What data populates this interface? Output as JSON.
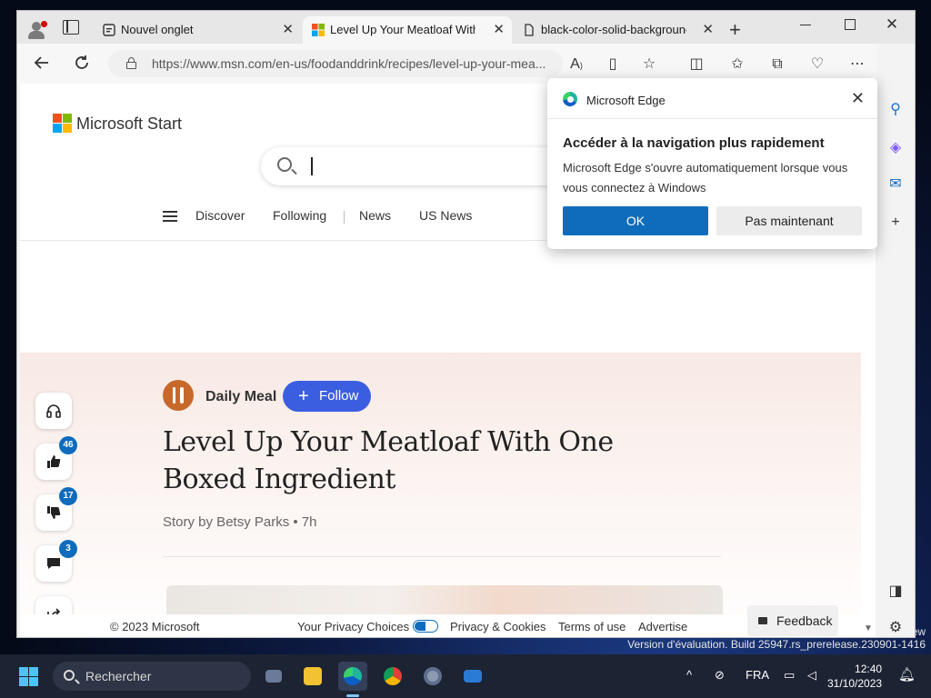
{
  "browser": {
    "tabs": [
      {
        "label": "Nouvel onglet",
        "close": "✕"
      },
      {
        "label": "Level Up Your Meatloaf With O",
        "close": "✕"
      },
      {
        "label": "black-color-solid-background-",
        "close": "✕"
      }
    ],
    "new_tab": "+",
    "url": "https://www.msn.com/en-us/foodanddrink/recipes/level-up-your-mea...",
    "window_close": "✕"
  },
  "site": {
    "brand": "Microsoft Start",
    "nav": [
      "Discover",
      "Following",
      "News",
      "US News"
    ]
  },
  "article": {
    "publisher": "Daily Meal",
    "follow_label": "Follow",
    "follow_plus": "+",
    "headline": "Level Up Your Meatloaf With One Boxed Ingredient",
    "byline": "Story by Betsy Parks  •  7h",
    "reactions": {
      "likes": "46",
      "dislikes": "17",
      "comments": "3"
    }
  },
  "footer": {
    "copyright": "© 2023 Microsoft",
    "privacy_choices": "Your Privacy Choices",
    "privacy_cookies": "Privacy & Cookies",
    "terms": "Terms of use",
    "advertise": "Advertise",
    "feedback": "Feedback"
  },
  "popup": {
    "title": "Microsoft Edge",
    "close": "✕",
    "heading": "Accéder à la navigation plus rapidement",
    "body": "Microsoft Edge s'ouvre automatiquement lorsque vous vous connectez à Windows",
    "ok": "OK",
    "later": "Pas maintenant"
  },
  "desktop": {
    "watermark_line1": "ew",
    "watermark_line2": "Version d'évaluation. Build 25947.rs_prerelease.230901-1416"
  },
  "taskbar": {
    "search": "Rechercher",
    "language": "FRA",
    "time": "12:40",
    "date": "31/10/2023",
    "tray_chevron": "^"
  },
  "colors": {
    "accent": "#0f6cbd",
    "follow": "#3b5ee0",
    "taskbar": "#1c2333"
  }
}
